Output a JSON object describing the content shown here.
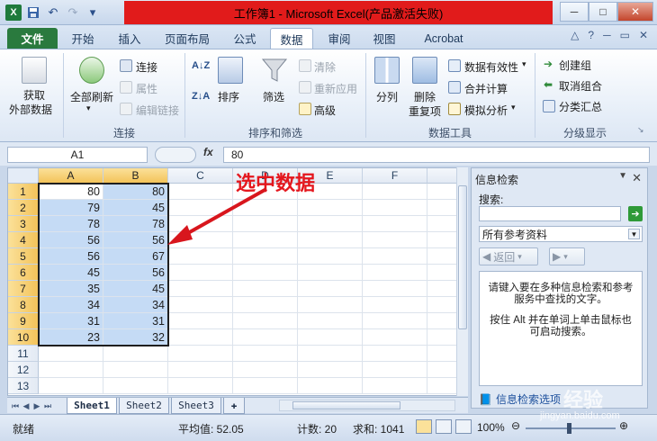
{
  "window": {
    "title": "工作簿1 - Microsoft Excel(产品激活失败)",
    "controls": {
      "minimize": "─",
      "maximize": "□",
      "close": "✕"
    }
  },
  "quick_access": {
    "app_icon": "X",
    "save": "💾",
    "undo": "↶",
    "redo": "↷",
    "more": "▾"
  },
  "tabs": [
    "文件",
    "开始",
    "插入",
    "页面布局",
    "公式",
    "数据",
    "审阅",
    "视图",
    "Acrobat"
  ],
  "active_tab": "数据",
  "ribbon": {
    "get_external": {
      "line1": "获取",
      "line2": "外部数据"
    },
    "refresh_all": "全部刷新",
    "connections": "连接",
    "properties": "属性",
    "edit_links": "编辑链接",
    "group_connections": "连接",
    "sort_az": "A↓Z",
    "sort_za": "Z↓A",
    "sort": "排序",
    "filter": "筛选",
    "clear": "清除",
    "reapply": "重新应用",
    "advanced": "高级",
    "group_sort_filter": "排序和筛选",
    "text_to_columns": "分列",
    "remove_dup_line1": "删除",
    "remove_dup_line2": "重复项",
    "data_validation": "数据有效性",
    "consolidate": "合并计算",
    "whatif": "模拟分析",
    "group_data_tools": "数据工具",
    "group": "创建组",
    "ungroup": "取消组合",
    "subtotal": "分类汇总",
    "group_outline": "分级显示"
  },
  "formula_bar": {
    "name_box": "A1",
    "fx": "fx",
    "value": "80"
  },
  "columns": [
    "A",
    "B",
    "C",
    "D",
    "E",
    "F"
  ],
  "rows": [
    "1",
    "2",
    "3",
    "4",
    "5",
    "6",
    "7",
    "8",
    "9",
    "10",
    "11",
    "12",
    "13"
  ],
  "cells": {
    "A": [
      "80",
      "79",
      "78",
      "56",
      "56",
      "45",
      "35",
      "34",
      "31",
      "23"
    ],
    "B": [
      "80",
      "45",
      "78",
      "56",
      "67",
      "56",
      "45",
      "34",
      "31",
      "32"
    ]
  },
  "annotation": "选中数据",
  "sheets": [
    "Sheet1",
    "Sheet2",
    "Sheet3"
  ],
  "research_pane": {
    "title": "信息检索",
    "search_label": "搜索:",
    "source": "所有参考资料",
    "back": "返回",
    "body_line1": "请键入要在多种信息检索和参考服务中查找的文字。",
    "body_line2": "按住 Alt 并在单词上单击鼠标也可启动搜索。",
    "footer": "信息检索选项"
  },
  "status": {
    "mode": "就绪",
    "average": "平均值: 52.05",
    "count": "计数: 20",
    "sum": "求和: 1041",
    "zoom": "100%"
  },
  "watermark": "经验",
  "watermark_url": "jingyan.baidu.com",
  "colors": {
    "selection": "#c5dbf5",
    "header_selected": "#f3c35a",
    "title_highlight": "#e11b1b",
    "annotation": "#e4161d"
  }
}
